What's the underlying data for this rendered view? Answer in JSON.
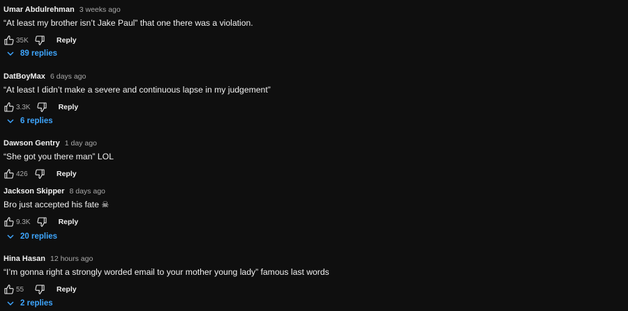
{
  "colors": {
    "background": "#0f0f0f",
    "text": "#f1f1f1",
    "secondary": "#aaaaaa",
    "link": "#3ea6ff"
  },
  "comments": [
    {
      "author": "Umar Abdulrehman",
      "time": "3 weeks ago",
      "text": "“At least my brother isn’t Jake Paul” that one there was a violation.",
      "likes": "35K",
      "reply_label": "Reply",
      "replies_label": "89 replies"
    },
    {
      "author": "DatBoyMax",
      "time": "6 days ago",
      "text": "“At least I didn’t make a severe and continuous lapse in my judgement”",
      "likes": "3.3K",
      "reply_label": "Reply",
      "replies_label": "6 replies"
    },
    {
      "author": "Dawson Gentry",
      "time": "1 day ago",
      "text": "“She got you there man” LOL",
      "likes": "426",
      "reply_label": "Reply"
    },
    {
      "author": "Jackson Skipper",
      "time": "8 days ago",
      "text": "Bro just accepted his fate ☠",
      "likes": "9.3K",
      "reply_label": "Reply",
      "replies_label": "20 replies"
    },
    {
      "author": "Hina Hasan",
      "time": "12 hours ago",
      "text": "“I’m gonna right a strongly worded email to your mother young lady” famous last words",
      "likes": "55",
      "reply_label": "Reply",
      "replies_label": "2 replies"
    }
  ]
}
